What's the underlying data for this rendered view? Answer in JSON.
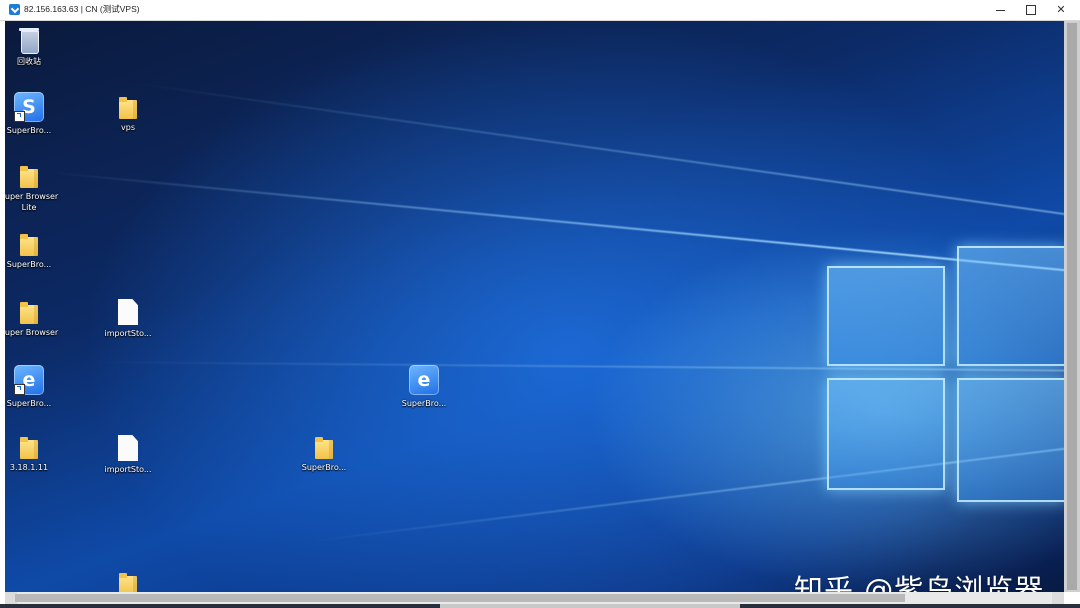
{
  "window": {
    "title": "82.156.163.63 | CN (测试VPS)"
  },
  "desktop": {
    "icons": [
      {
        "id": "recycle",
        "label": "回收站",
        "type": "recycle-bin"
      },
      {
        "id": "superbro1",
        "label": "SuperBro...",
        "type": "app-shortcut"
      },
      {
        "id": "vps",
        "label": "vps",
        "type": "folder"
      },
      {
        "id": "super-browser-lite",
        "label": "Super Browser Lite",
        "type": "folder"
      },
      {
        "id": "superbro-folder",
        "label": "SuperBro...",
        "type": "folder"
      },
      {
        "id": "super-browser",
        "label": "Super Browser",
        "type": "folder"
      },
      {
        "id": "importsto1",
        "label": "importSto...",
        "type": "file"
      },
      {
        "id": "superbro2",
        "label": "SuperBro...",
        "type": "app-shortcut"
      },
      {
        "id": "superbro3",
        "label": "SuperBro...",
        "type": "app"
      },
      {
        "id": "ver-3181",
        "label": "3.18.1.11",
        "type": "folder"
      },
      {
        "id": "importsto2",
        "label": "importSto...",
        "type": "file"
      },
      {
        "id": "superbro-folder2",
        "label": "SuperBro...",
        "type": "folder"
      },
      {
        "id": "folder-bottom",
        "label": "",
        "type": "folder"
      }
    ]
  },
  "watermark": "知乎 @紫鸟浏览器",
  "colors": {
    "folder": "#f2c24a",
    "app_accent": "#1f6fe6",
    "wallpaper_dark": "#0b1a3d",
    "wallpaper_light": "#6fb7ff"
  }
}
